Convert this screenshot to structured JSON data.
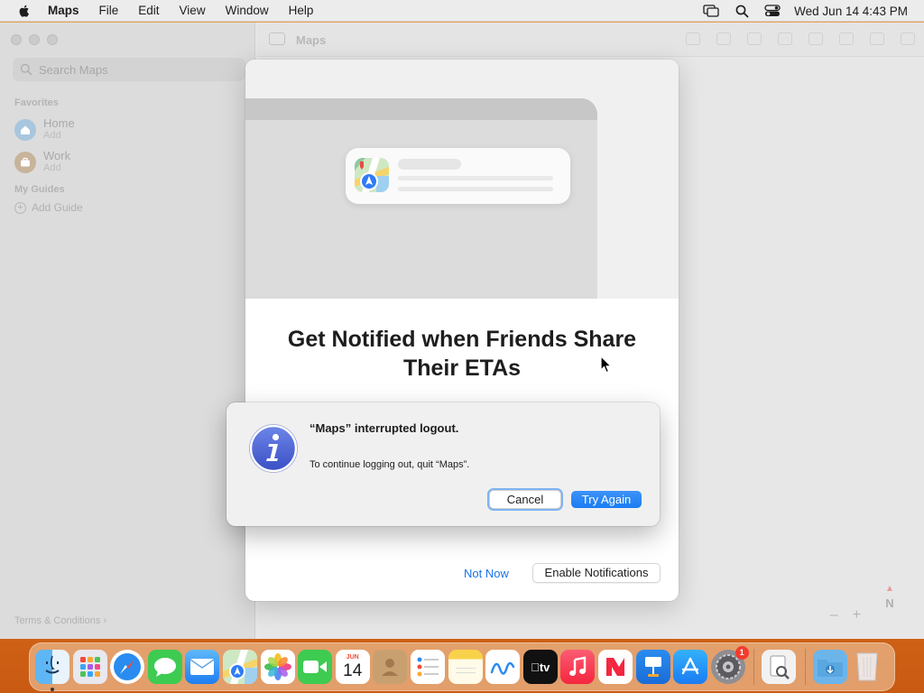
{
  "menubar": {
    "app_name": "Maps",
    "menus": [
      "File",
      "Edit",
      "View",
      "Window",
      "Help"
    ],
    "clock": "Wed Jun 14  4:43 PM"
  },
  "maps_window": {
    "title": "Maps",
    "search_placeholder": "Search Maps",
    "favorites_header": "Favorites",
    "favorites": [
      {
        "name": "Home",
        "sub": "Add"
      },
      {
        "name": "Work",
        "sub": "Add"
      }
    ],
    "guides_header": "My Guides",
    "add_guide": "Add Guide",
    "terms": "Terms & Conditions",
    "compass_label": "N",
    "zoom_out": "–",
    "zoom_in": "+"
  },
  "sheet": {
    "title_line1": "Get Notified when Friends Share",
    "title_line2": "Their ETAs",
    "not_now": "Not Now",
    "enable": "Enable Notifications"
  },
  "alert": {
    "title": "“Maps” interrupted logout.",
    "message": "To continue logging out, quit “Maps”.",
    "cancel": "Cancel",
    "try_again": "Try Again"
  },
  "dock": {
    "apps": [
      "Finder",
      "Launchpad",
      "Safari",
      "Messages",
      "Mail",
      "Maps",
      "Photos",
      "FaceTime",
      "Calendar",
      "Contacts",
      "Reminders",
      "Notes",
      "Freeform",
      "TV",
      "Music",
      "News",
      "Keynote",
      "App Store",
      "System Settings",
      "Preview",
      "Downloads",
      "Trash"
    ],
    "calendar_month": "JUN",
    "calendar_day": "14",
    "settings_badge": "1",
    "tv_label": "tv"
  }
}
